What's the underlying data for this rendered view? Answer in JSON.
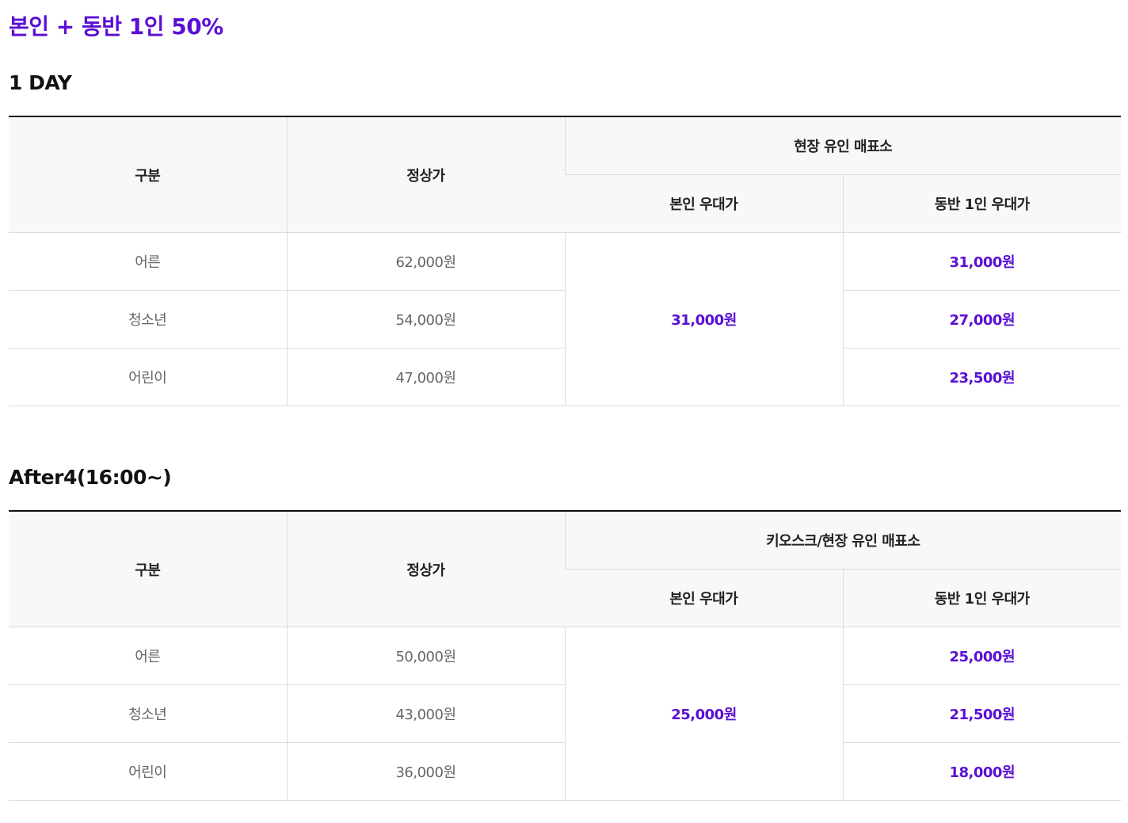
{
  "promo_title": "본인 + 동반 1인 50%",
  "headers": {
    "category": "구분",
    "regular_price": "정상가",
    "self_discount": "본인 우대가",
    "companion_discount": "동반 1인 우대가"
  },
  "sections": [
    {
      "title": "1 DAY",
      "group_header": "현장 유인 매표소",
      "self_price": "31,000원",
      "rows": [
        {
          "category": "어른",
          "regular": "62,000원",
          "companion": "31,000원"
        },
        {
          "category": "청소년",
          "regular": "54,000원",
          "companion": "27,000원"
        },
        {
          "category": "어린이",
          "regular": "47,000원",
          "companion": "23,500원"
        }
      ]
    },
    {
      "title": "After4(16:00~)",
      "group_header": "키오스크/현장 유인 매표소",
      "self_price": "25,000원",
      "rows": [
        {
          "category": "어른",
          "regular": "50,000원",
          "companion": "25,000원"
        },
        {
          "category": "청소년",
          "regular": "43,000원",
          "companion": "21,500원"
        },
        {
          "category": "어린이",
          "regular": "36,000원",
          "companion": "18,000원"
        }
      ]
    }
  ],
  "colors": {
    "accent": "#5a0fd4",
    "header_bg": "#f8f8f8",
    "border": "#dddddd",
    "table_top_border": "#111111"
  }
}
